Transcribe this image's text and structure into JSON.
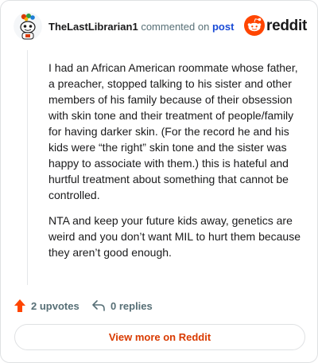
{
  "header": {
    "username": "TheLastLibrarian1",
    "action_text": "commented on",
    "post_link": "post",
    "brand": "reddit"
  },
  "comment": {
    "paragraphs": [
      "I had an African American roommate whose father, a preacher, stopped talking to his sister and other members of his family because of their obsession with skin tone and their treatment of people/family for having darker skin. (For the record he and his kids were “the right” skin tone and the sister was happy to associate with them.) this is hateful and hurtful treatment about something that cannot be controlled.",
      "NTA and keep your future kids away, genetics are weird and you don’t want MIL to hurt them because they aren’t good enough."
    ]
  },
  "actions": {
    "upvotes": "2 upvotes",
    "replies": "0 replies"
  },
  "footer": {
    "view_more": "View more on Reddit"
  },
  "colors": {
    "reddit_orange": "#ff4500",
    "link_blue": "#1a4bd6",
    "cta_text": "#d93a00"
  }
}
